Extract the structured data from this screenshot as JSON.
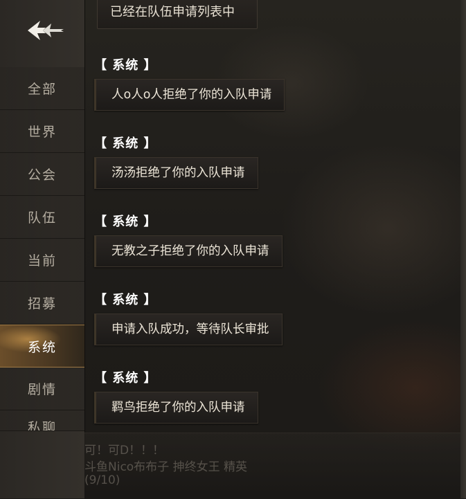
{
  "sidebar": {
    "tabs": [
      {
        "label": "全部",
        "active": false
      },
      {
        "label": "世界",
        "active": false
      },
      {
        "label": "公会",
        "active": false
      },
      {
        "label": "队伍",
        "active": false
      },
      {
        "label": "当前",
        "active": false
      },
      {
        "label": "招募",
        "active": false
      },
      {
        "label": "系统",
        "active": true
      },
      {
        "label": "剧情",
        "active": false
      },
      {
        "label": "私聊",
        "active": false
      }
    ]
  },
  "messages": {
    "previous": "已经在队伍申请列表中",
    "items": [
      {
        "tag": "【 系统 】",
        "text": "人o人o人拒绝了你的入队申请"
      },
      {
        "tag": "【 系统 】",
        "text": "汤汤拒绝了你的入队申请"
      },
      {
        "tag": "【 系统 】",
        "text": "无教之子拒绝了你的入队申请"
      },
      {
        "tag": "【 系统 】",
        "text": "申请入队成功，等待队长审批"
      },
      {
        "tag": "【 系统 】",
        "text": "羁鸟拒绝了你的入队申请"
      }
    ]
  },
  "background_text": {
    "line1": "可！可D！！！",
    "line2": "斗鱼Nico布布子  抻终女王  精英",
    "line3": "(9/10)"
  },
  "colors": {
    "accent": "#6b4e2a",
    "active_border": "#a07a45",
    "panel": "#1d1c1a"
  }
}
